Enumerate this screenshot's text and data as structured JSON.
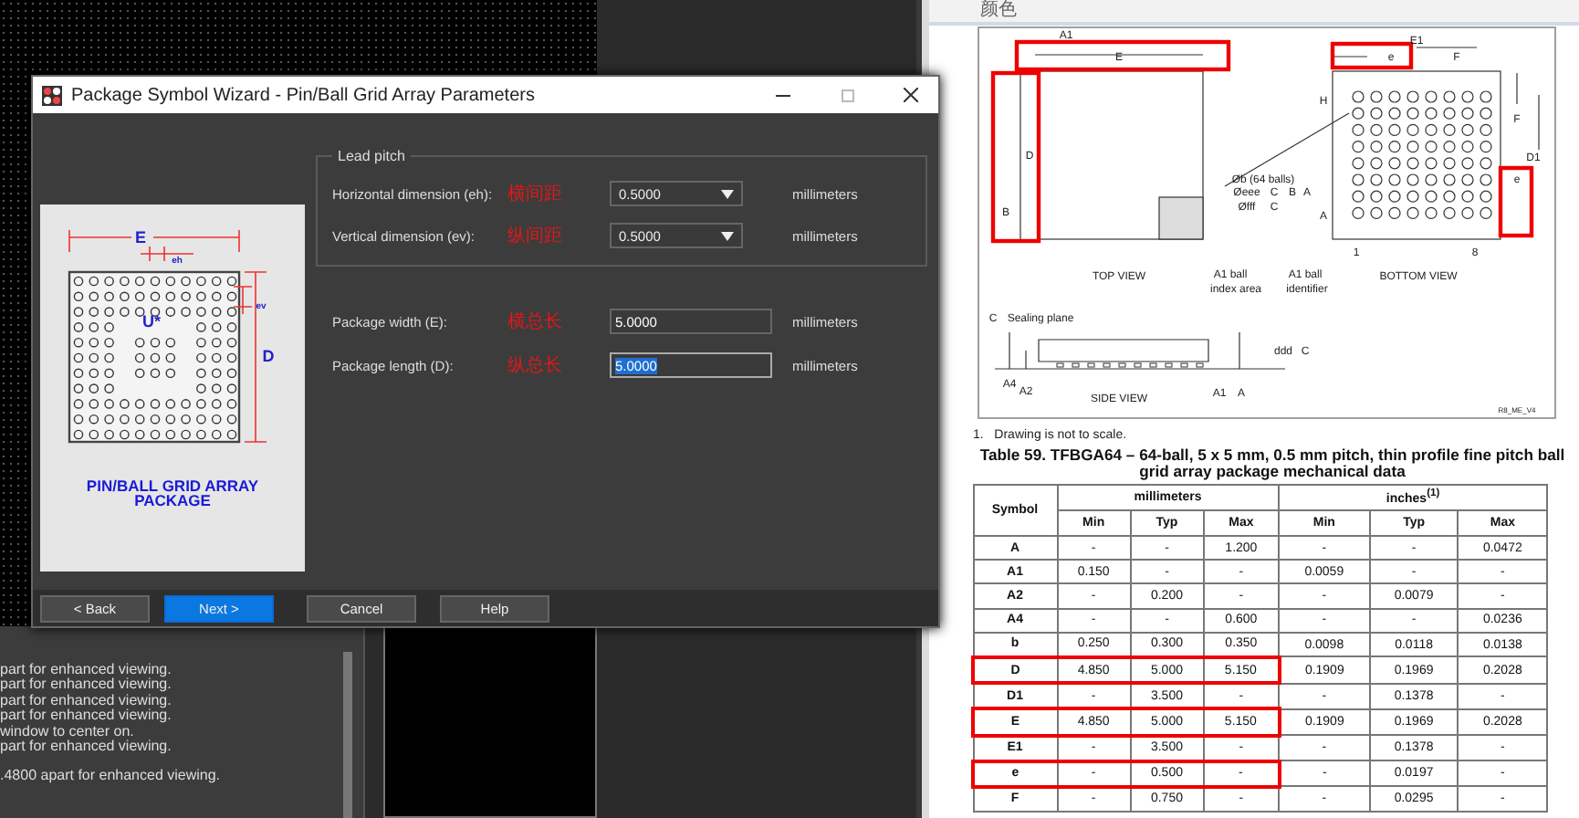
{
  "app": {
    "log_lines": [
      "part for enhanced viewing.",
      "part for enhanced viewing.",
      "part for enhanced viewing.",
      "part for enhanced viewing.",
      "window to center on.",
      "part for enhanced viewing.",
      ".4800 apart for enhanced viewing."
    ]
  },
  "dialog": {
    "title": "Package Symbol Wizard - Pin/Ball Grid Array Parameters",
    "preview": {
      "labels": [
        "E",
        "eh",
        "ev",
        "U*",
        "D"
      ],
      "caption": "PIN/BALL GRID ARRAY PACKAGE"
    },
    "lead_pitch": {
      "title": "Lead pitch",
      "rows": [
        {
          "label": "Horizontal dimension (eh):",
          "note": "横间距",
          "value": "0.5000",
          "unit": "millimeters"
        },
        {
          "label": "Vertical dimension (ev):",
          "note": "纵间距",
          "value": "0.5000",
          "unit": "millimeters"
        }
      ]
    },
    "size_rows": [
      {
        "label": "Package width (E):",
        "note": "横总长",
        "value": "5.0000",
        "unit": "millimeters",
        "selected": false
      },
      {
        "label": "Package length (D):",
        "note": "纵总长",
        "value": "5.0000",
        "unit": "millimeters",
        "selected": true
      }
    ],
    "buttons": [
      {
        "label": "< Back",
        "kind": "normal"
      },
      {
        "label": "Next >",
        "kind": "primary"
      },
      {
        "label": "Cancel",
        "kind": "normal"
      },
      {
        "label": "Help",
        "kind": "normal"
      }
    ]
  },
  "pdf": {
    "header": "颜色",
    "drawing": {
      "labels": [
        "A1",
        "E",
        "D",
        "B",
        "E1",
        "e",
        "F",
        "H",
        "F",
        "D1",
        "e",
        "A",
        "1",
        "8",
        "Øb (64 balls)",
        "Øeee",
        "C",
        "B",
        "A",
        "Øfff",
        "C",
        "TOP VIEW",
        "A1 ball",
        "index area",
        "A1 ball",
        "identifier",
        "BOTTOM VIEW",
        "C",
        "Sealing plane",
        "A4",
        "A2",
        "SIDE VIEW",
        "A1",
        "A",
        "ddd",
        "C",
        "R8_ME_V4"
      ]
    },
    "footnote": "1.   Drawing is not to scale.",
    "table": {
      "title": "Table 59. TFBGA64 – 64-ball, 5 x 5 mm, 0.5 mm pitch, thin profile fine pitch ball grid array package mechanical data",
      "symbol_header": "Symbol",
      "groups": [
        "millimeters",
        "inches$^{(1)}$"
      ],
      "subheaders": [
        "Min",
        "Typ",
        "Max",
        "Min",
        "Typ",
        "Max"
      ],
      "rows": [
        {
          "cells": [
            "A",
            "-",
            "-",
            "1.200",
            "-",
            "-",
            "0.0472"
          ],
          "highlighted": false
        },
        {
          "cells": [
            "A1",
            "0.150",
            "-",
            "-",
            "0.0059",
            "-",
            "-"
          ],
          "highlighted": false
        },
        {
          "cells": [
            "A2",
            "-",
            "0.200",
            "-",
            "-",
            "0.0079",
            "-"
          ],
          "highlighted": false
        },
        {
          "cells": [
            "A4",
            "-",
            "-",
            "0.600",
            "-",
            "-",
            "0.0236"
          ],
          "highlighted": false
        },
        {
          "cells": [
            "b",
            "0.250",
            "0.300",
            "0.350",
            "0.0098",
            "0.0118",
            "0.0138"
          ],
          "highlighted": false
        },
        {
          "cells": [
            "D",
            "4.850",
            "5.000",
            "5.150",
            "0.1909",
            "0.1969",
            "0.2028"
          ],
          "highlighted": true
        },
        {
          "cells": [
            "D1",
            "-",
            "3.500",
            "-",
            "-",
            "0.1378",
            "-"
          ],
          "highlighted": false
        },
        {
          "cells": [
            "E",
            "4.850",
            "5.000",
            "5.150",
            "0.1909",
            "0.1969",
            "0.2028"
          ],
          "highlighted": true
        },
        {
          "cells": [
            "E1",
            "-",
            "3.500",
            "-",
            "-",
            "0.1378",
            "-"
          ],
          "highlighted": false
        },
        {
          "cells": [
            "e",
            "-",
            "0.500",
            "-",
            "-",
            "0.0197",
            "-"
          ],
          "highlighted": true
        },
        {
          "cells": [
            "F",
            "-",
            "0.750",
            "-",
            "-",
            "0.0295",
            "-"
          ],
          "highlighted": false
        }
      ]
    }
  }
}
